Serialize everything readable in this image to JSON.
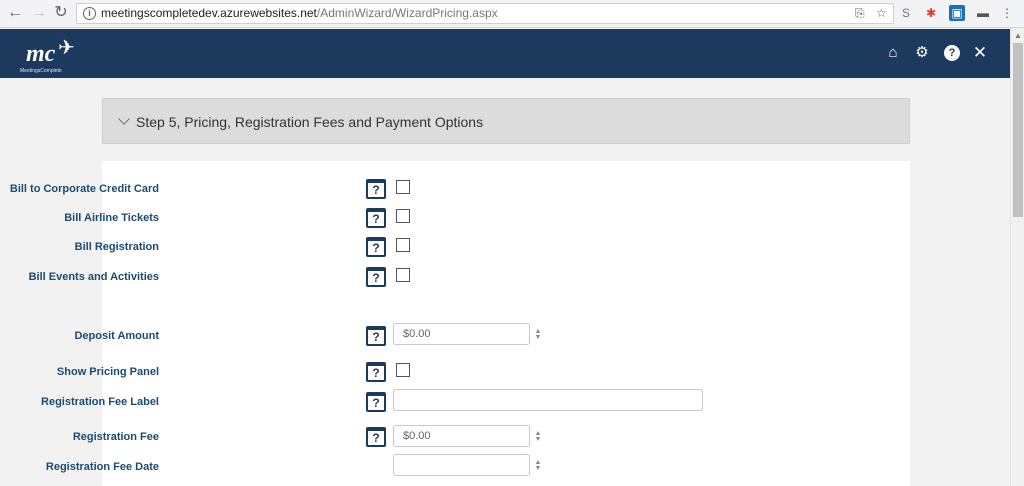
{
  "browser": {
    "url_host": "meetingscompletedev.azurewebsites.net",
    "url_path": "/AdminWizard/WizardPricing.aspx",
    "icons": [
      "back-icon",
      "forward-icon",
      "reload-icon",
      "info-icon",
      "translate-icon",
      "star-icon",
      "menu-icon"
    ]
  },
  "app": {
    "logo_text": "mc",
    "logo_subtext": "MeetingsComplete",
    "header_color": "#1c3a5e"
  },
  "step": {
    "title": "Step 5, Pricing, Registration Fees and Payment Options"
  },
  "form": {
    "help_label": "?",
    "bill_corporate_label": "Bill to Corporate Credit Card",
    "bill_airline_label": "Bill Airline Tickets",
    "bill_registration_label": "Bill Registration",
    "bill_events_label": "Bill Events and Activities",
    "deposit_label": "Deposit Amount",
    "deposit_value": "$0.00",
    "show_pricing_label": "Show Pricing Panel",
    "reg_fee_label_label": "Registration Fee Label",
    "reg_fee_label_value": "",
    "reg_fee_label": "Registration Fee",
    "reg_fee_value": "$0.00",
    "reg_fee_date_label": "Registration Fee Date",
    "reg_fee_date_value": ""
  }
}
